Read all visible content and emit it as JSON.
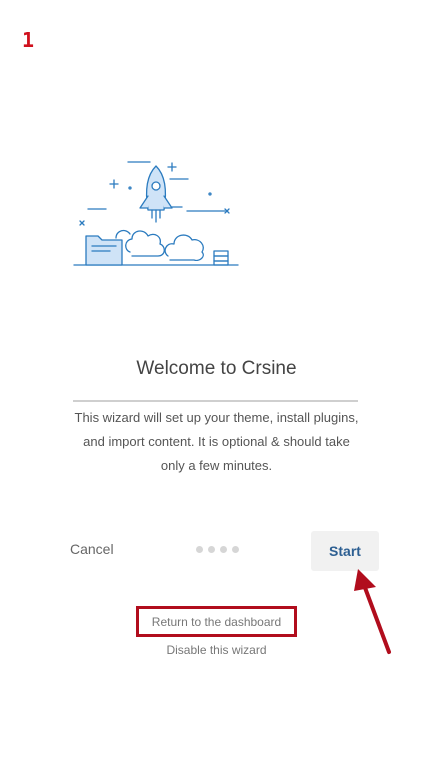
{
  "annotation": {
    "step_number": "1"
  },
  "wizard": {
    "title": "Welcome to Crsine",
    "description": "This wizard will set up your theme, install plugins, and import content. It is optional & should take only a few minutes.",
    "cancel_label": "Cancel",
    "start_label": "Start",
    "progress_steps": 4
  },
  "links": {
    "return_dashboard": "Return to the dashboard",
    "disable_wizard": "Disable this wizard"
  },
  "colors": {
    "annotation_red": "#b10d1d",
    "start_text": "#2d5f92",
    "illustration_blue": "#2b7bbf",
    "illustration_fill": "#cfe3f7"
  },
  "icons": {
    "illustration": "rocket-launch-illustration",
    "annotation_arrow": "red-arrow-icon"
  }
}
